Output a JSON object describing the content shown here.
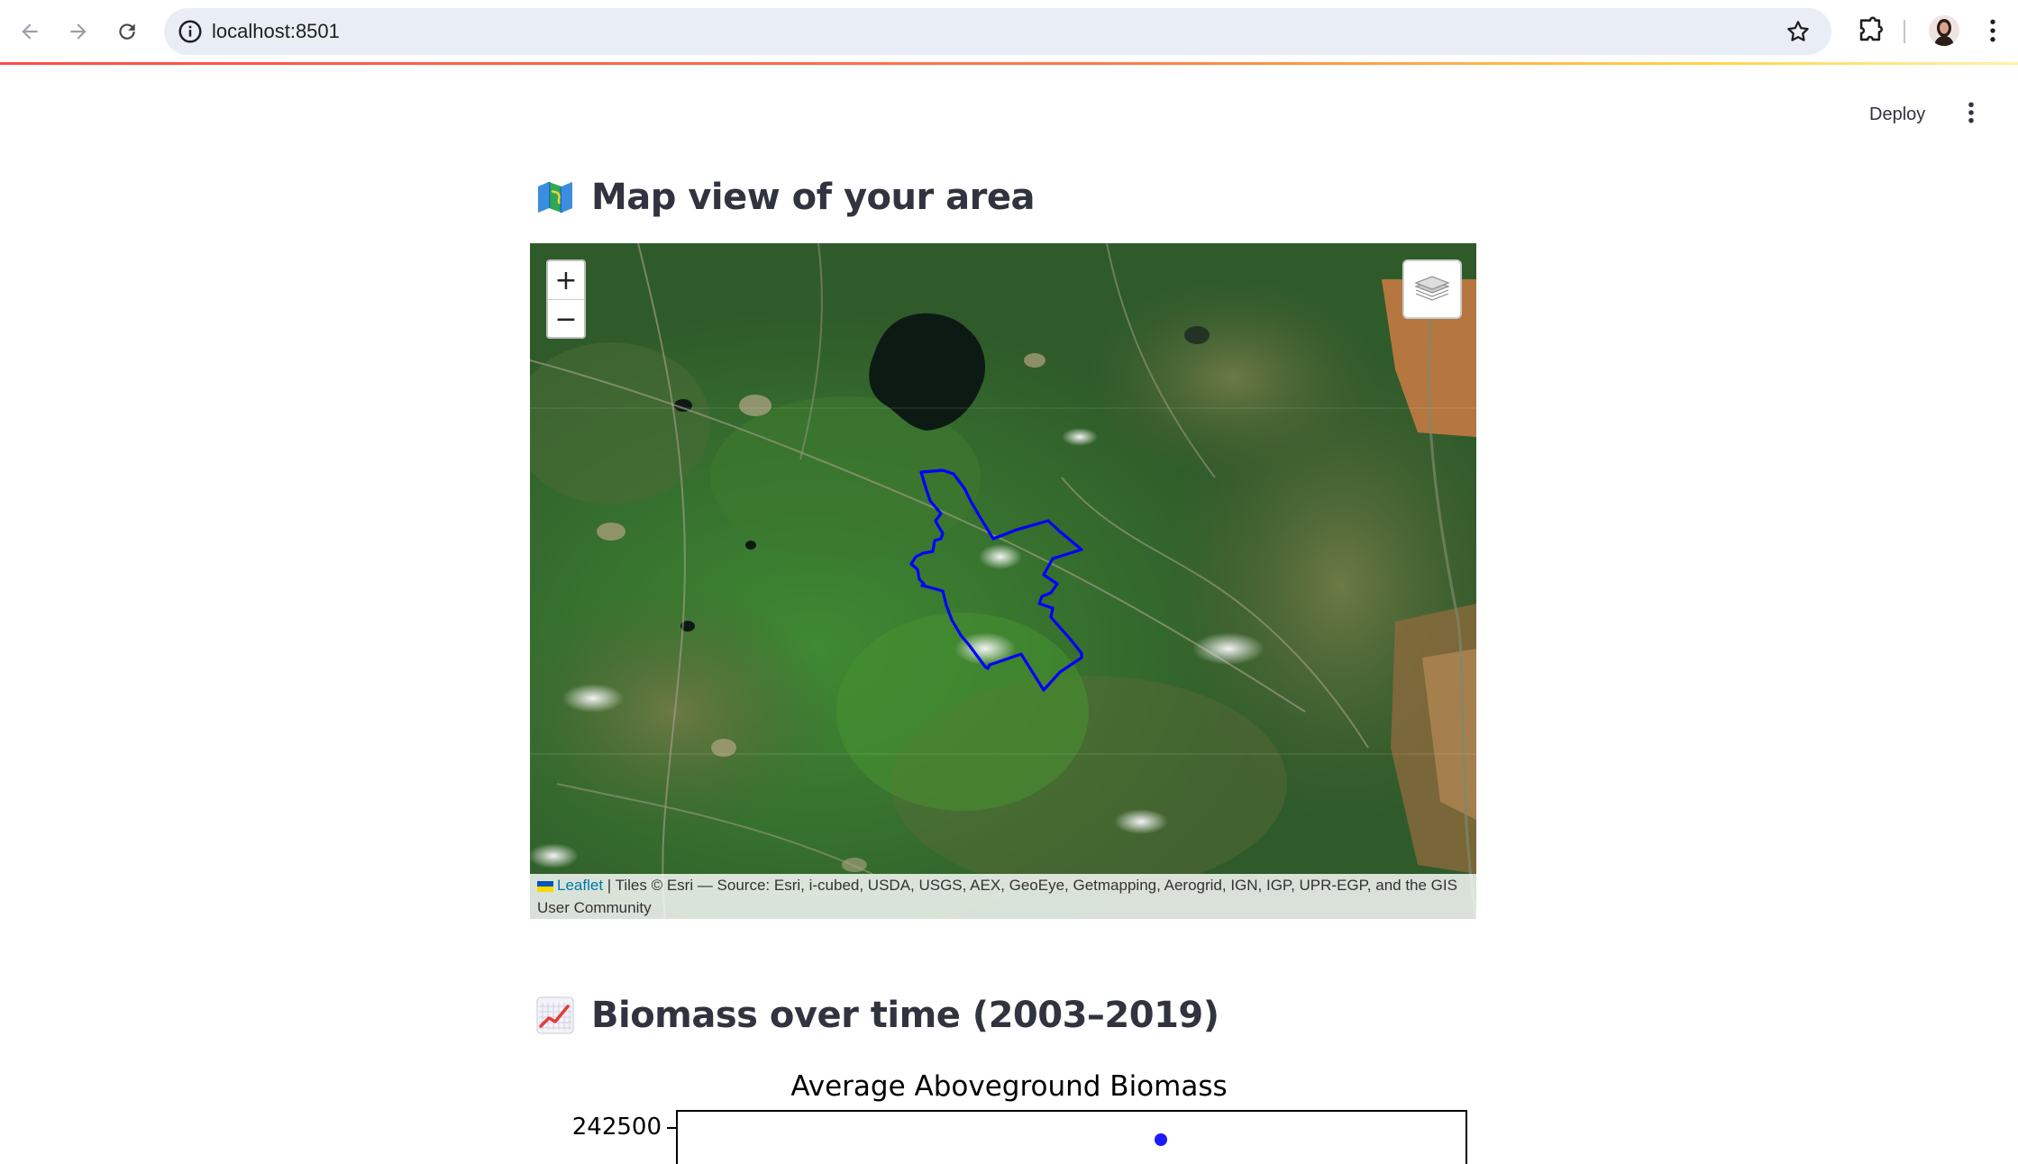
{
  "browser": {
    "url": "localhost:8501",
    "icons": [
      "back-arrow-icon",
      "forward-arrow-icon",
      "reload-icon",
      "site-info-icon",
      "bookmark-star-icon",
      "extensions-icon",
      "profile-avatar",
      "chrome-menu-icon"
    ]
  },
  "app_header": {
    "deploy_label": "Deploy"
  },
  "map_section": {
    "heading": "Map view of your area",
    "heading_icon": "map-icon",
    "zoom_in": "+",
    "zoom_out": "−",
    "attribution_link": "Leaflet",
    "attribution_text": " | Tiles © Esri — Source: Esri, i-cubed, USDA, USGS, AEX, GeoEye, Getmapping, Aerogrid, IGN, IGP, UPR-EGP, and the GIS User Community",
    "polygon_color": "#0000ff"
  },
  "chart_section": {
    "heading": "Biomass over time (2003–2019)",
    "heading_icon": "chart-increasing-icon"
  },
  "chart_data": {
    "type": "line",
    "title": "Average Aboveground Biomass",
    "yticks": [
      "242500"
    ],
    "series_color": "#1a1aff"
  },
  "colors": {
    "text": "#31333f",
    "accent": "#ff4b4b",
    "omnibox": "#e9eef6"
  }
}
